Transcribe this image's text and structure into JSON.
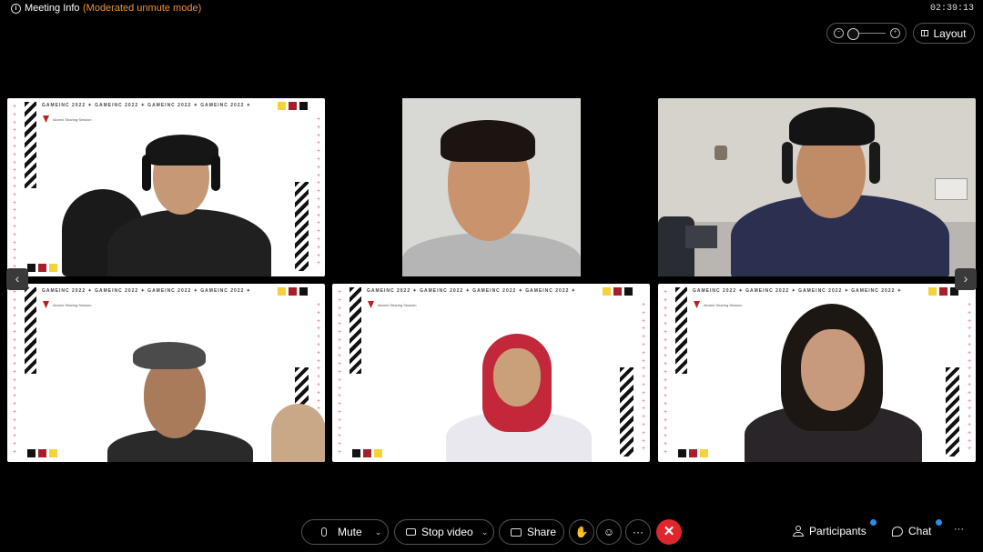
{
  "topbar": {
    "meeting_info": "Meeting Info",
    "mode": "(Moderated unmute mode)",
    "clock": "02:39:13",
    "layout_label": "Layout"
  },
  "frame": {
    "header": "GAMEINC 2022  ✦  GAMEINC 2022  ✦  GAMEINC 2022  ✦  GAMEINC 2022  ✦",
    "subtitle": "Alumni Sharing Session"
  },
  "nav": {
    "prev": "‹",
    "next": "›"
  },
  "controls": {
    "mute": "Mute",
    "stop_video": "Stop video",
    "share": "Share",
    "more": "···",
    "participants": "Participants",
    "chat": "Chat",
    "overflow": "···"
  },
  "colors": {
    "accent_orange": "#f0913a",
    "end_red": "#e0262d",
    "badge_blue": "#2e8ce6",
    "brand_red": "#a61f2a",
    "brand_yellow": "#f3d23a"
  }
}
